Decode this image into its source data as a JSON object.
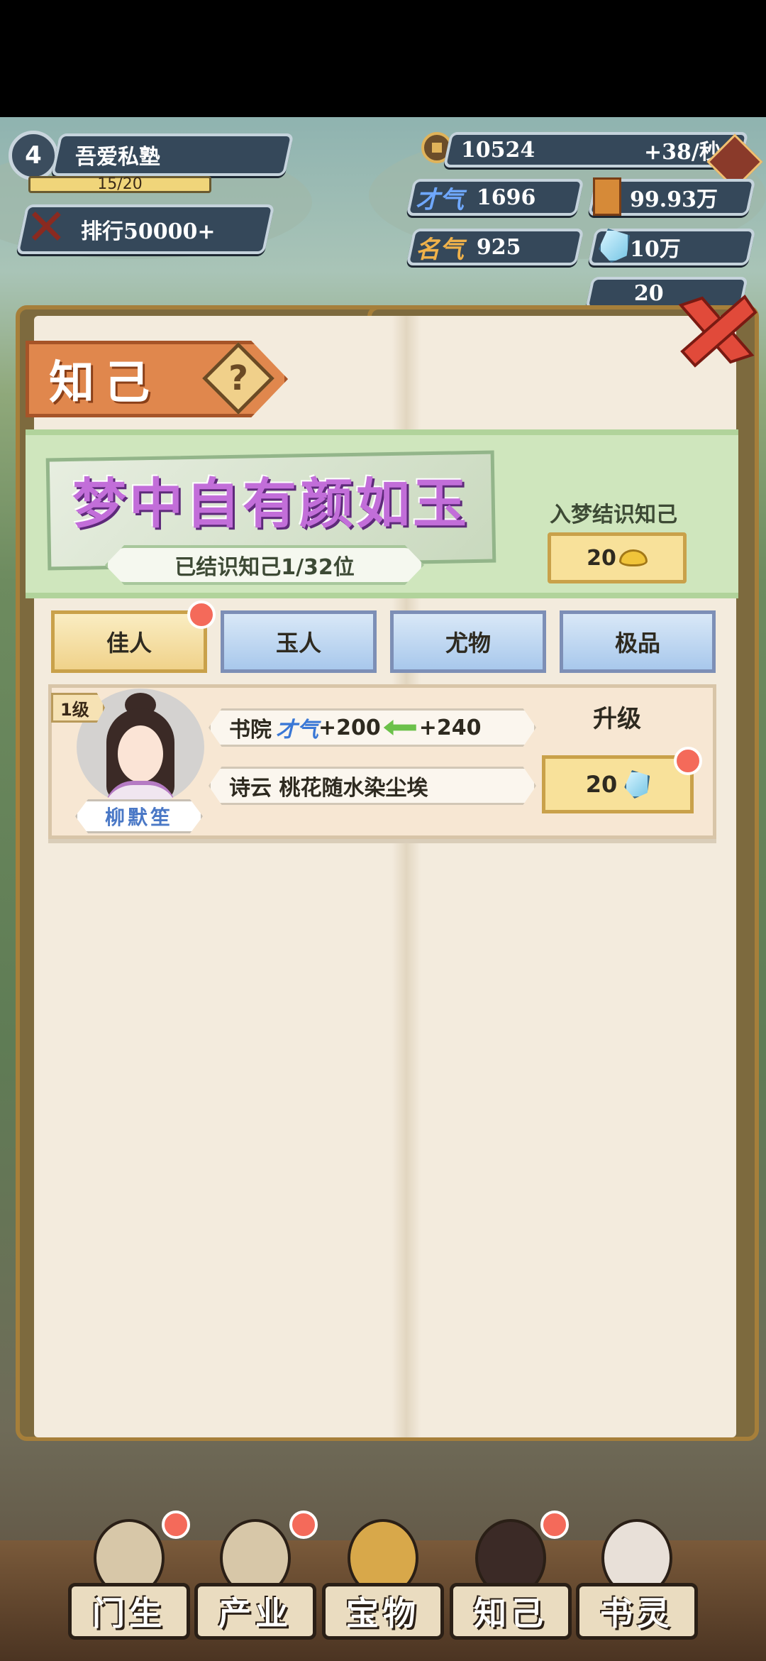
{
  "player": {
    "level": "4",
    "school_name": "吾爱私塾",
    "exp": "15/20",
    "rank": "排行50000+"
  },
  "resources": {
    "coins": "10524",
    "coins_rate": "+38/秒",
    "talent": "1696",
    "gold_value": "99.93万",
    "fame": "925",
    "diamond": "10万",
    "ingot_partial": "20"
  },
  "panel": {
    "title": "知己",
    "help_symbol": "?",
    "slogan": "梦中自有颜如玉",
    "known_count": "已结识知己1/32位",
    "dream_label": "入梦结识知己",
    "dream_cost": "20"
  },
  "tabs": [
    {
      "label": "佳人",
      "active": true,
      "badge": true
    },
    {
      "label": "玉人",
      "active": false,
      "badge": false
    },
    {
      "label": "尤物",
      "active": false,
      "badge": false
    },
    {
      "label": "极品",
      "active": false,
      "badge": false
    }
  ],
  "confidant": {
    "level": "1级",
    "name": "柳默笙",
    "stat_prefix": "书院",
    "stat_talent": "才气",
    "stat_talent_value": "+200",
    "stat_arrow_value": "+240",
    "poem": "诗云 桃花随水染尘埃",
    "upgrade_label": "升级",
    "upgrade_cost": "20"
  },
  "nav": [
    {
      "label": "门生",
      "badge": true
    },
    {
      "label": "产业",
      "badge": true
    },
    {
      "label": "宝物",
      "badge": false
    },
    {
      "label": "知己",
      "badge": true
    },
    {
      "label": "书灵",
      "badge": false
    }
  ],
  "colors": {
    "accent_orange": "#e0874d",
    "slogan_purple": "#c26ed9",
    "badge_red": "#f46a5a",
    "gold_button": "#f8e19a"
  }
}
